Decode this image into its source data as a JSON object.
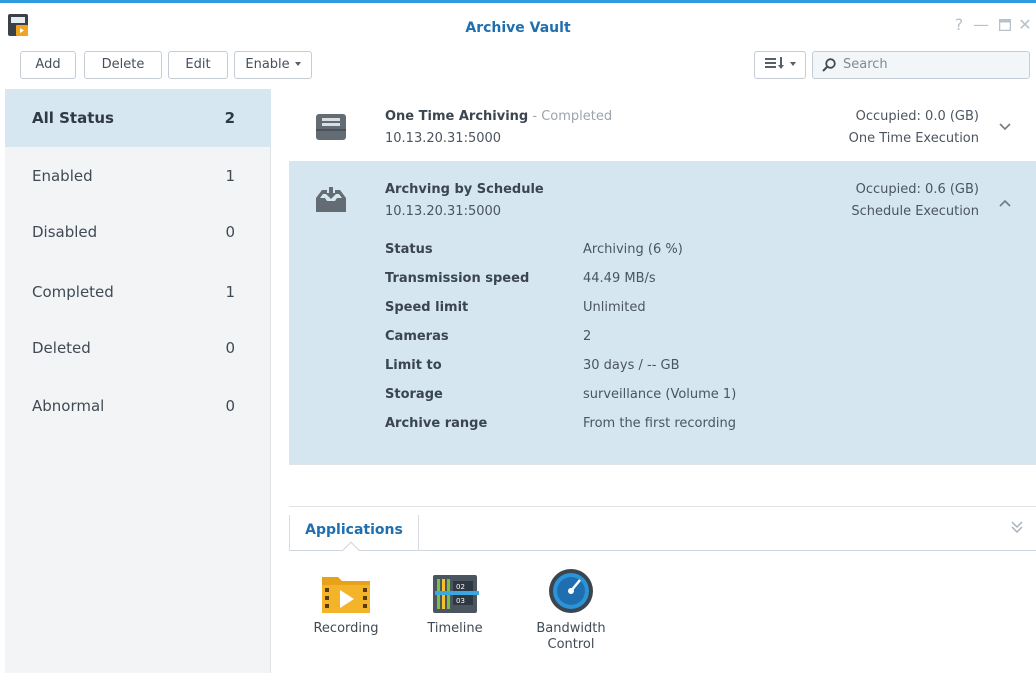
{
  "window": {
    "title": "Archive Vault"
  },
  "toolbar": {
    "add": "Add",
    "delete": "Delete",
    "edit": "Edit",
    "enable": "Enable",
    "sort_icon": "sort-icon",
    "search_placeholder": "Search"
  },
  "sidebar": {
    "items": [
      {
        "label": "All Status",
        "count": "2",
        "active": true
      },
      {
        "label": "Enabled",
        "count": "1"
      },
      {
        "label": "Disabled",
        "count": "0"
      },
      {
        "label": "Completed",
        "count": "1"
      },
      {
        "label": "Deleted",
        "count": "0"
      },
      {
        "label": "Abnormal",
        "count": "0"
      }
    ]
  },
  "tasks": [
    {
      "name": "One Time Archiving",
      "status": " - Completed",
      "address": "10.13.20.31:5000",
      "occupied": "Occupied: 0.0 (GB)",
      "execution": "One Time Execution"
    },
    {
      "name": "Archving by Schedule",
      "address": "10.13.20.31:5000",
      "occupied": "Occupied: 0.6 (GB)",
      "execution": "Schedule Execution",
      "details": [
        {
          "key": "Status",
          "value": "Archiving (6 %)"
        },
        {
          "key": "Transmission speed",
          "value": "44.49 MB/s"
        },
        {
          "key": "Speed limit",
          "value": "Unlimited"
        },
        {
          "key": "Cameras",
          "value": "2"
        },
        {
          "key": "Limit to",
          "value": "30 days / -- GB"
        },
        {
          "key": "Storage",
          "value": "surveillance (Volume 1)"
        },
        {
          "key": "Archive range",
          "value": "From the first recording"
        }
      ]
    }
  ],
  "applications": {
    "tab": "Applications",
    "items": [
      {
        "label": "Recording",
        "icon": "recording-icon"
      },
      {
        "label": "Timeline",
        "icon": "timeline-icon"
      },
      {
        "label": "Bandwidth Control",
        "icon": "bandwidth-control-icon"
      }
    ]
  },
  "colors": {
    "accent": "#1f6fb0",
    "selected_row": "#d5e6f1",
    "title_bar_line": "#2f9bdf"
  }
}
